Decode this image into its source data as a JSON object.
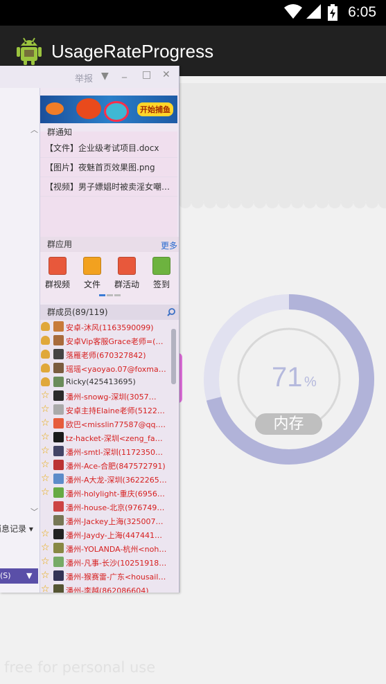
{
  "status_bar": {
    "time": "6:05"
  },
  "app": {
    "title": "UsageRateProgress"
  },
  "gauge": {
    "percent": 71,
    "value_text": "71",
    "unit": "%",
    "label": "内存",
    "track_color": "#e1e1f0",
    "progress_color": "#b1b3d9"
  },
  "qq_window": {
    "report_label": "举报",
    "ad_button": "开始捕鱼",
    "notice_title": "群通知",
    "notices": [
      "【文件】企业级考试项目.docx",
      "【图片】夜魅首页效果图.png",
      "【视频】男子嫖娼时被卖淫女嘲笑…"
    ],
    "apps_title": "群应用",
    "more_label": "更多",
    "apps": [
      {
        "label": "群视频",
        "color": "#e8583b"
      },
      {
        "label": "文件",
        "color": "#f2a11f"
      },
      {
        "label": "群活动",
        "color": "#e8583b"
      },
      {
        "label": "签到",
        "color": "#6db33f"
      }
    ],
    "members_title": "群成员(89/119)",
    "members": [
      {
        "name": "安卓-沐风(1163590099)",
        "color": "#d62020",
        "badge": "user"
      },
      {
        "name": "安卓Vip客服Grace老师=(1…",
        "color": "#d62020",
        "badge": "user"
      },
      {
        "name": "落雁老师(670327842)",
        "color": "#d62020",
        "badge": "user"
      },
      {
        "name": "瑶瑶<yaoyao.07@foxmail.…",
        "color": "#d62020",
        "badge": "user"
      },
      {
        "name": "Ricky(425413695)",
        "color": "#333333",
        "badge": "user"
      },
      {
        "name": "潘州-snowg-深圳(3057…",
        "color": "#d62020",
        "badge": "star"
      },
      {
        "name": "安卓主持Elaine老师(51229…",
        "color": "#d62020",
        "badge": "star"
      },
      {
        "name": "欧巴<misslin77587@qq.com>",
        "color": "#d62020",
        "badge": "star"
      },
      {
        "name": "tz-hacket-深圳<zeng_fans…",
        "color": "#d62020",
        "badge": "star"
      },
      {
        "name": "潘州-smtl-深圳(1172350020)",
        "color": "#d62020",
        "badge": "star"
      },
      {
        "name": "潘州-Ace-合肥(847572791)",
        "color": "#d62020",
        "badge": "star"
      },
      {
        "name": "潘州-A大龙-深圳(3622265…",
        "color": "#d62020",
        "badge": "star"
      },
      {
        "name": "潘州-holylight-重庆(695686…",
        "color": "#d62020",
        "badge": "star"
      },
      {
        "name": "潘州-house-北京(976749139)",
        "color": "#d62020",
        "badge": "none"
      },
      {
        "name": "潘州-Jackey上海(325007080)",
        "color": "#d62020",
        "badge": "none"
      },
      {
        "name": "潘州-Jaydy-上海(447441601)",
        "color": "#d62020",
        "badge": "star"
      },
      {
        "name": "潘州-YOLANDA-杭州<noht…",
        "color": "#d62020",
        "badge": "star"
      },
      {
        "name": "潘州-凡事-长沙(1025191869)",
        "color": "#d62020",
        "badge": "star"
      },
      {
        "name": "潘州-猴赛雷-广东<housaill…",
        "color": "#d62020",
        "badge": "star"
      },
      {
        "name": "潘州-李越(862086604)",
        "color": "#d62020",
        "badge": "star"
      }
    ],
    "left_msg": "消息记录",
    "left_button": "(S)"
  },
  "watermark": "free for personal use"
}
